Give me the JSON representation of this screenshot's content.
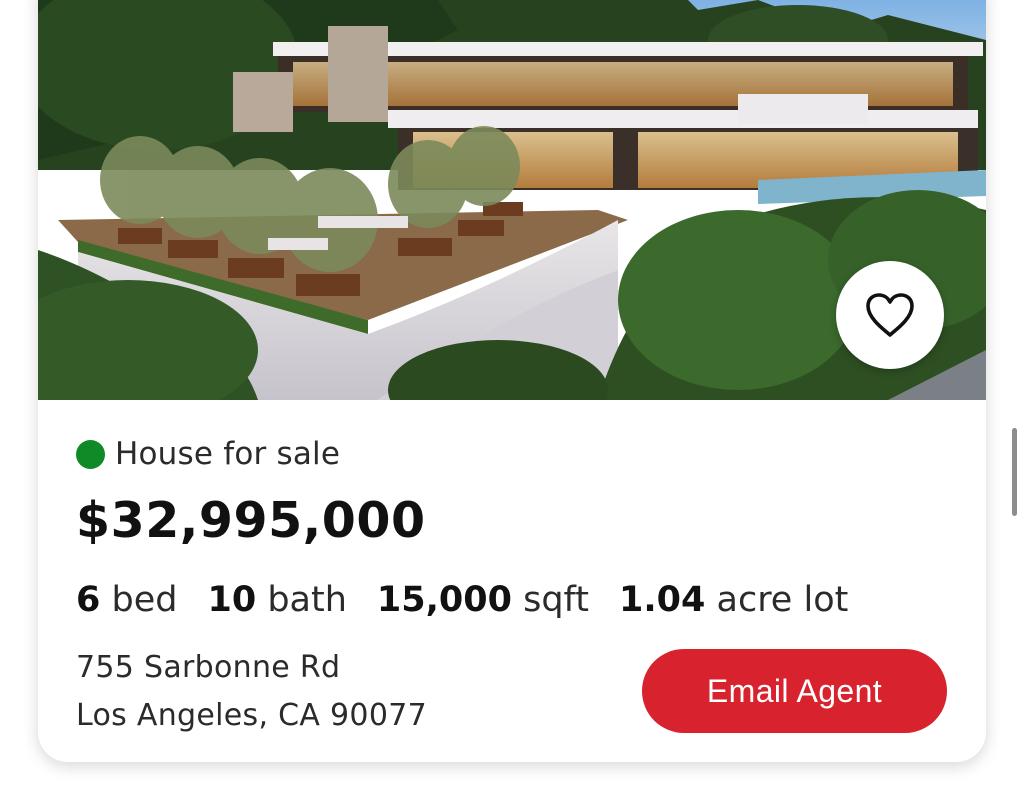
{
  "listing": {
    "status": "House for sale",
    "status_color": "#0f8a26",
    "price": "$32,995,000",
    "specs": [
      {
        "value": "6",
        "unit": "bed"
      },
      {
        "value": "10",
        "unit": "bath"
      },
      {
        "value": "15,000",
        "unit": "sqft"
      },
      {
        "value": "1.04",
        "unit": "acre lot"
      }
    ],
    "address_line1": "755 Sarbonne Rd",
    "address_line2": "Los Angeles, CA 90077",
    "email_button_label": "Email Agent",
    "accent_color": "#d8232f",
    "favorite_icon": "heart-outline-icon"
  }
}
